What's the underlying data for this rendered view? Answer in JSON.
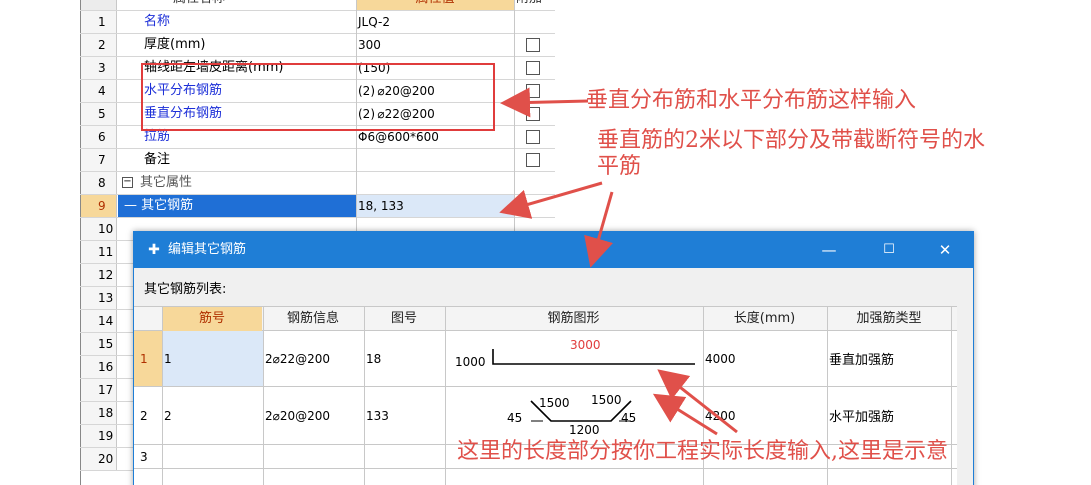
{
  "property_grid": {
    "header": {
      "row_number": "",
      "name_col": "属性名称",
      "value_col": "属性值",
      "add_col": "附加"
    },
    "rows": [
      {
        "num": "1",
        "name": "名称",
        "value": "JLQ-2",
        "color": "blue",
        "checkbox": false
      },
      {
        "num": "2",
        "name": "厚度(mm)",
        "value": "300",
        "color": "black",
        "checkbox": true
      },
      {
        "num": "3",
        "name": "轴线距左墙皮距离(mm)",
        "value": "(150)",
        "color": "black",
        "checkbox": true
      },
      {
        "num": "4",
        "name": "水平分布钢筋",
        "value": "(2) ⌀20@200",
        "color": "blue",
        "checkbox": true
      },
      {
        "num": "5",
        "name": "垂直分布钢筋",
        "value": "(2) ⌀22@200",
        "color": "blue",
        "checkbox": true
      },
      {
        "num": "6",
        "name": "拉筋",
        "value": "Φ6@600*600",
        "color": "blue",
        "checkbox": true
      },
      {
        "num": "7",
        "name": "备注",
        "value": "",
        "color": "black",
        "checkbox": true
      },
      {
        "num": "8",
        "name": "其它属性",
        "value": "",
        "color": "gray",
        "checkbox": false,
        "collapse": "−"
      },
      {
        "num": "9",
        "name": "其它钢筋",
        "value": "18, 133",
        "color": "white",
        "checkbox": false,
        "selected": true
      },
      {
        "num": "10"
      },
      {
        "num": "11"
      },
      {
        "num": "12"
      },
      {
        "num": "13"
      },
      {
        "num": "14"
      },
      {
        "num": "15"
      },
      {
        "num": "16"
      },
      {
        "num": "17"
      },
      {
        "num": "18"
      },
      {
        "num": "19"
      },
      {
        "num": "20"
      }
    ]
  },
  "dialog": {
    "title": "编辑其它钢筋",
    "icon": "app-plus-icon",
    "minimize": "—",
    "maximize": "☐",
    "close": "✕",
    "list_label": "其它钢筋列表:",
    "columns": [
      "筋号",
      "钢筋信息",
      "图号",
      "钢筋图形",
      "长度(mm)",
      "加强筋类型"
    ],
    "rows": [
      {
        "idx": "1",
        "no": "1",
        "info": "2⌀22@200",
        "fig": "18",
        "length": "4000",
        "type": "垂直加强筋",
        "shape": {
          "left_dim": "1000",
          "top_dim": "3000"
        }
      },
      {
        "idx": "2",
        "no": "2",
        "info": "2⌀20@200",
        "fig": "133",
        "length": "4200",
        "type": "水平加强筋",
        "shape": {
          "left_angle": "45",
          "right_angle": "45",
          "left_dim": "1500",
          "right_dim": "1500",
          "bottom_dim": "1200"
        }
      },
      {
        "idx": "3",
        "no": "",
        "info": "",
        "fig": "",
        "length": "",
        "type": ""
      }
    ]
  },
  "annotations": {
    "note1": "垂直分布筋和水平分布筋这样输入",
    "note2_line1": "垂直筋的2米以下部分及带截断符号的水",
    "note2_line2": "平筋",
    "note3": "这里的长度部分按你工程实际长度输入,这里是示意",
    "color": "#e0504a"
  }
}
